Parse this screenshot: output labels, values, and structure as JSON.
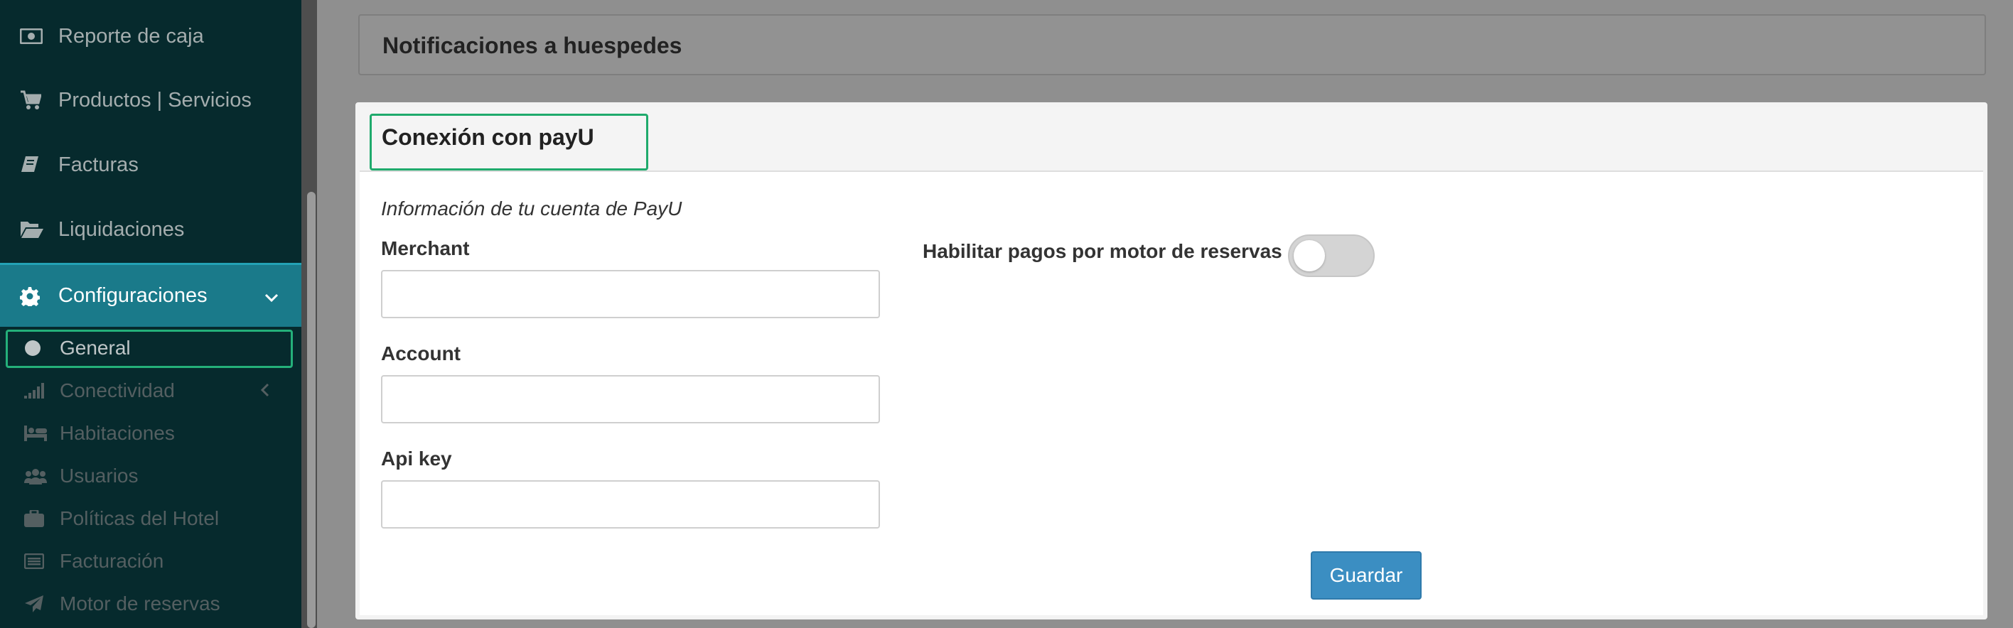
{
  "sidebar": {
    "items": [
      {
        "label": "Reporte de caja",
        "icon": "money-icon"
      },
      {
        "label": "Productos | Servicios",
        "icon": "cart-icon"
      },
      {
        "label": "Facturas",
        "icon": "book-icon"
      },
      {
        "label": "Liquidaciones",
        "icon": "folder-open-icon"
      },
      {
        "label": "Configuraciones",
        "icon": "gear-icon"
      }
    ],
    "submenu": [
      {
        "label": "General",
        "icon": "circle-icon"
      },
      {
        "label": "Conectividad",
        "icon": "signal-icon"
      },
      {
        "label": "Habitaciones",
        "icon": "bed-icon"
      },
      {
        "label": "Usuarios",
        "icon": "users-icon"
      },
      {
        "label": "Políticas del Hotel",
        "icon": "briefcase-icon"
      },
      {
        "label": "Facturación",
        "icon": "list-alt-icon"
      },
      {
        "label": "Motor de reservas",
        "icon": "paper-plane-icon"
      }
    ]
  },
  "main": {
    "notifications_title": "Notificaciones a huespedes",
    "payu": {
      "title": "Conexión con payU",
      "info": "Información de tu cuenta de PayU",
      "merchant_label": "Merchant",
      "merchant_value": "",
      "account_label": "Account",
      "account_value": "",
      "apikey_label": "Api key",
      "apikey_value": "",
      "toggle_label": "Habilitar pagos por motor de reservas",
      "toggle_on": false,
      "save_label": "Guardar"
    }
  },
  "colors": {
    "sidebar_bg": "#062a2d",
    "active_item_bg": "#1a7a8a",
    "focus_outline": "#1faa6c",
    "save_button": "#3b8ec2"
  }
}
